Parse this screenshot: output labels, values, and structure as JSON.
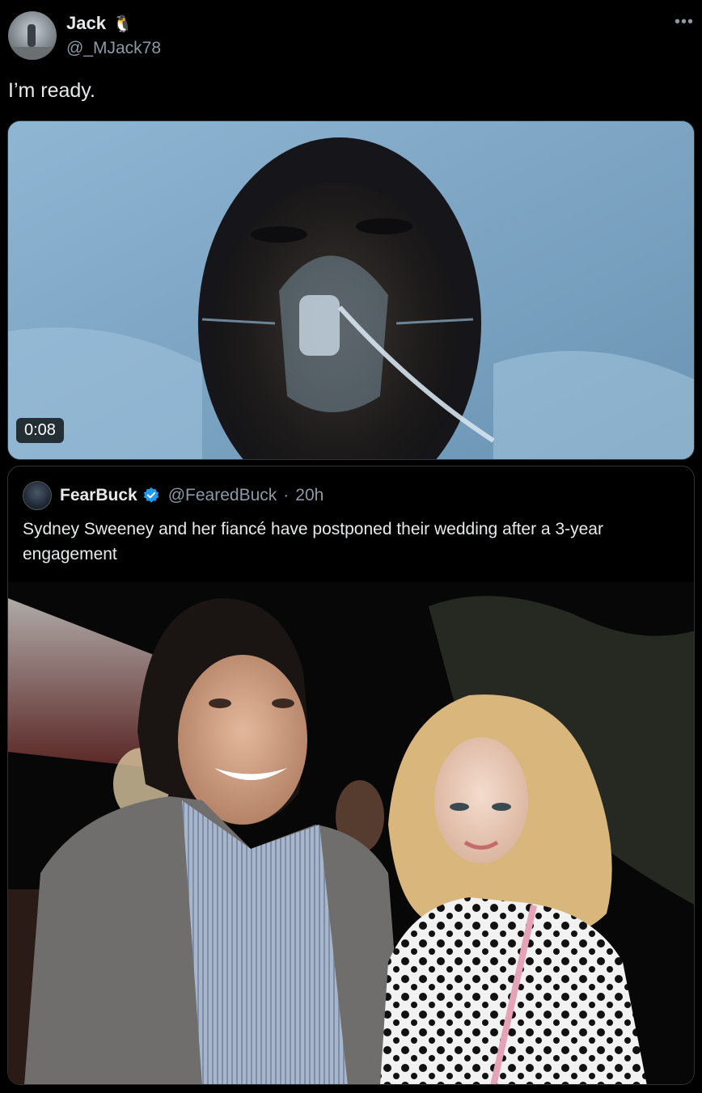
{
  "tweet": {
    "display_name": "Jack",
    "name_emoji": "🐧",
    "handle": "@_MJack78",
    "more_icon": "more-horizontal-icon",
    "text": "I’m ready.",
    "video_duration": "0:08"
  },
  "quoted": {
    "display_name": "FearBuck",
    "handle": "@FearedBuck",
    "separator": "·",
    "time": "20h",
    "text": "Sydney Sweeney and her fiancé have postponed their wedding after a 3-year engagement",
    "verified_color": "#1d9bf0"
  },
  "colors": {
    "background": "#000000",
    "text_primary": "#e7e9ea",
    "text_secondary": "#8b98a5",
    "border": "#2f3336"
  }
}
